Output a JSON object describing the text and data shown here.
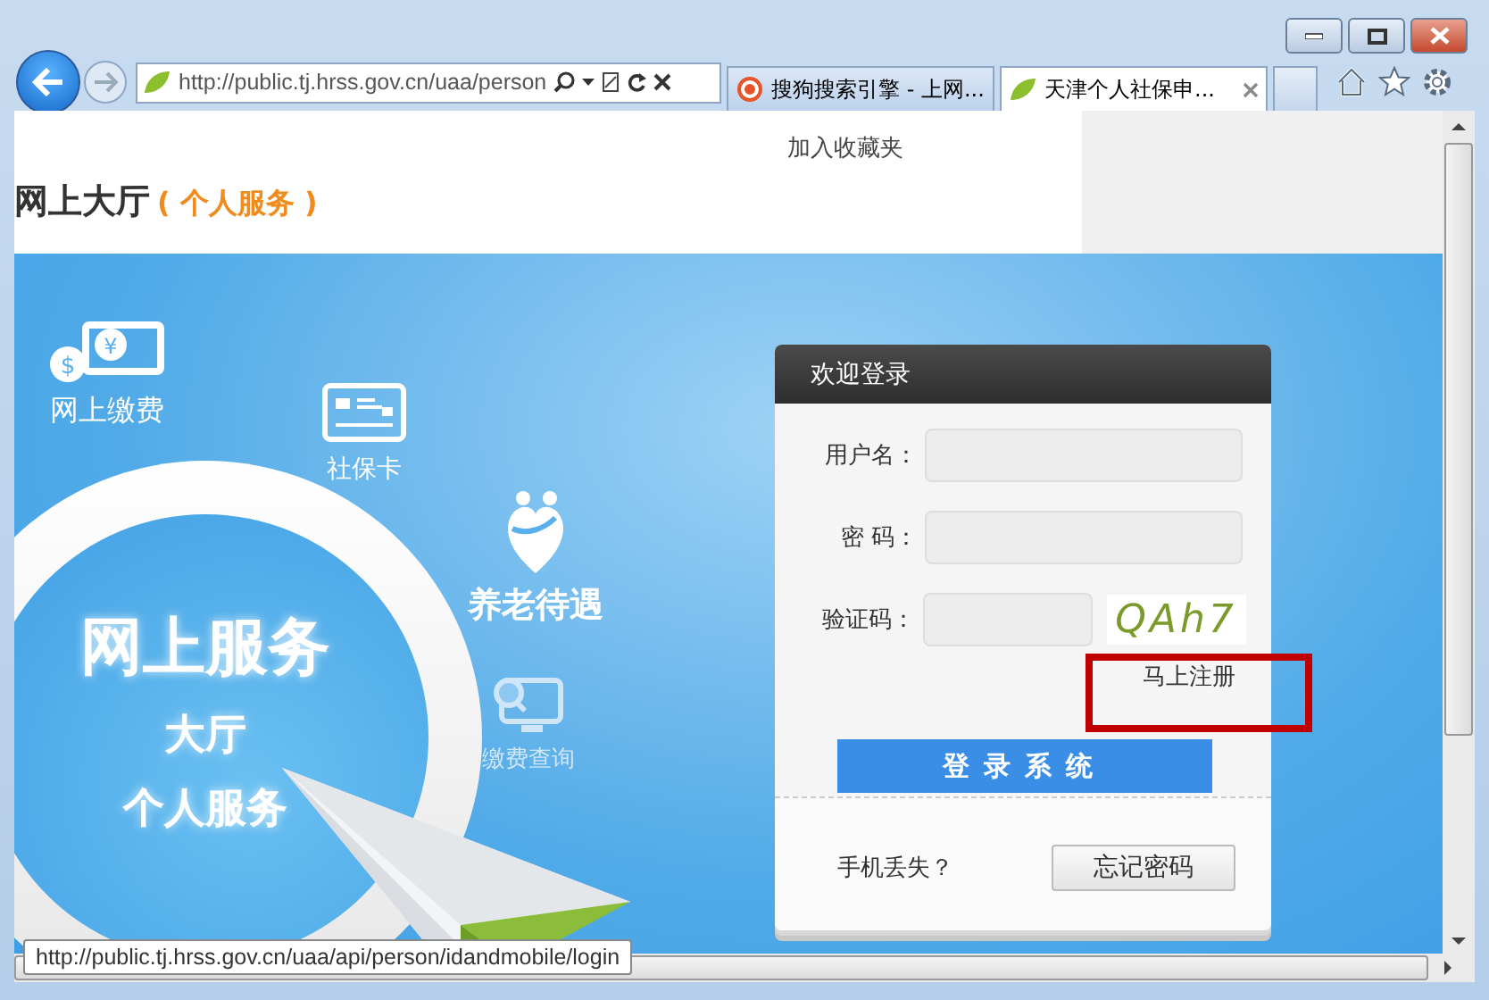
{
  "browser": {
    "address": "http://public.tj.hrss.gov.cn/uaa/person",
    "tabs": [
      {
        "title": "搜狗搜索引擎 - 上网...",
        "kind": "search",
        "selected": false
      },
      {
        "title": "天津个人社保申...",
        "kind": "leaf",
        "selected": true
      }
    ]
  },
  "header": {
    "bookmark_link": "加入收藏夹",
    "title": "网上大厅",
    "subtitle": "( 个人服务 )"
  },
  "banner": {
    "services": [
      {
        "kind": "payment",
        "label": "网上缴费",
        "glyphs": [
          "$",
          "¥"
        ]
      },
      {
        "kind": "card",
        "label": "社保卡"
      },
      {
        "kind": "pension",
        "label": "养老待遇"
      },
      {
        "kind": "query",
        "label": "缴费查询"
      }
    ],
    "hero": [
      "网上服务",
      "大厅",
      "个人服务"
    ]
  },
  "login": {
    "title": "欢迎登录",
    "fields": [
      {
        "label": "用户名：",
        "kind": "text"
      },
      {
        "label": "密 码：",
        "kind": "password"
      },
      {
        "label": "验证码：",
        "kind": "captcha",
        "captcha": "QAh7"
      }
    ],
    "register_link": "马上注册",
    "submit": "登录系统",
    "lost_phone": "手机丢失？",
    "forgot_button": "忘记密码"
  },
  "status_url": "http://public.tj.hrss.gov.cn/uaa/api/person/idandmobile/login"
}
